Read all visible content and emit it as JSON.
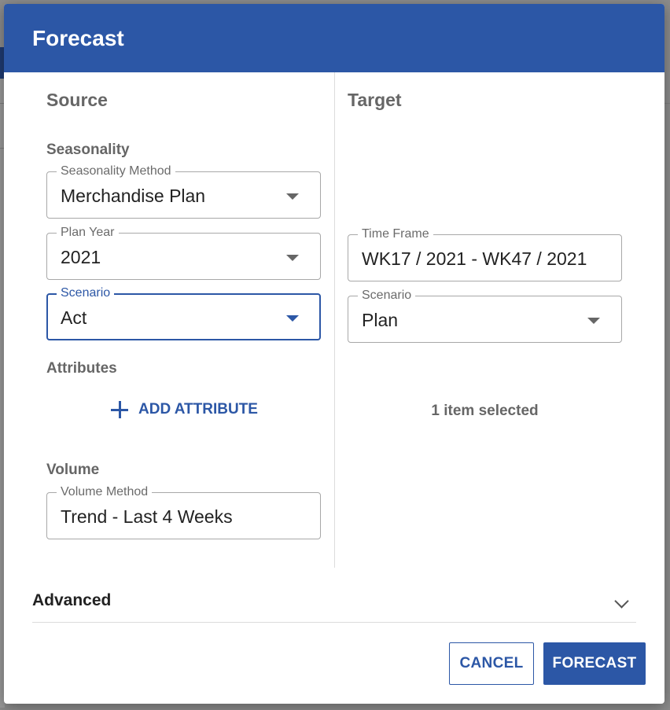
{
  "dialog": {
    "title": "Forecast",
    "source": {
      "title": "Source",
      "seasonality_label": "Seasonality",
      "seasonality_method": {
        "legend": "Seasonality Method",
        "value": "Merchandise Plan"
      },
      "plan_year": {
        "legend": "Plan Year",
        "value": "2021"
      },
      "scenario": {
        "legend": "Scenario",
        "value": "Act"
      },
      "attributes_label": "Attributes",
      "add_attribute_label": "ADD ATTRIBUTE",
      "volume_label": "Volume",
      "volume_method": {
        "legend": "Volume Method",
        "value": "Trend - Last 4 Weeks"
      }
    },
    "target": {
      "title": "Target",
      "time_frame": {
        "legend": "Time Frame",
        "value": "WK17 / 2021 - WK47 / 2021"
      },
      "scenario": {
        "legend": "Scenario",
        "value": "Plan"
      },
      "selection_summary": "1 item selected"
    },
    "advanced_label": "Advanced",
    "buttons": {
      "cancel": "CANCEL",
      "forecast": "FORECAST"
    }
  },
  "colors": {
    "primary": "#2c57a6",
    "muted_text": "#666666"
  },
  "icons": [
    "chevron-down-icon",
    "plus-icon",
    "dropdown-caret-icon"
  ]
}
